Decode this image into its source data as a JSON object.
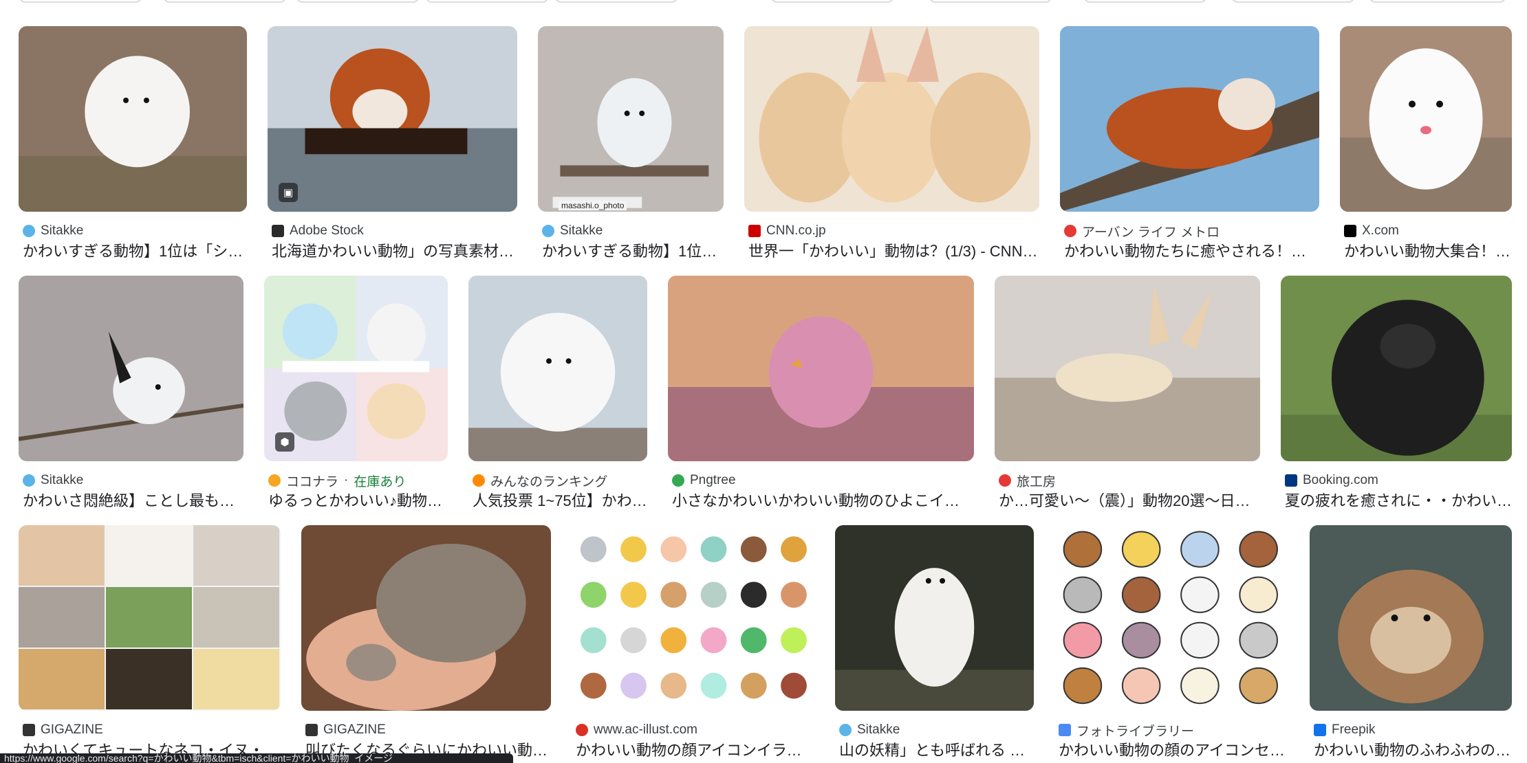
{
  "results": [
    {
      "source": "Sitakke",
      "title": "かわいすぎる動物】1位は「シ…",
      "favicon": "sitakke-icon",
      "fav_color": "#5ab4e8"
    },
    {
      "source": "Adobe Stock",
      "title": "北海道かわいい動物」の写真素材 | …",
      "favicon": "adobe-stock-icon",
      "fav_color": "#2b2b2b",
      "badge": "image-icon"
    },
    {
      "source": "Sitakke",
      "title": "かわいすぎる動物】1位…",
      "favicon": "sitakke-icon",
      "fav_color": "#5ab4e8",
      "watermark": "masashi.o_photo"
    },
    {
      "source": "CNN.co.jp",
      "title": "世界一「かわいい」動物は？(1/3) - CNN.…",
      "favicon": "cnn-icon",
      "fav_color": "#cc0000"
    },
    {
      "source": "アーバン ライフ メトロ",
      "title": "かわいい動物たちに癒やされる！都…",
      "favicon": "urban-life-icon",
      "fav_color": "#e53935"
    },
    {
      "source": "X.com",
      "title": "かわいい動物大集合！ …",
      "favicon": "x-icon",
      "fav_color": "#000000"
    },
    {
      "source": "Sitakke",
      "title": "かわいさ悶絶級】ことし最も「…",
      "favicon": "sitakke-icon",
      "fav_color": "#5ab4e8"
    },
    {
      "source": "ココナラ",
      "source_suffix": "在庫あり",
      "title": "ゆるっとかわいい♪動物…",
      "favicon": "coconala-icon",
      "fav_color": "#f5a623",
      "badge": "tag-icon"
    },
    {
      "source": "みんなのランキング",
      "title": "人気投票 1~75位】かわ…",
      "favicon": "minna-ranking-icon",
      "fav_color": "#ff8a00"
    },
    {
      "source": "Pngtree",
      "title": "小さなかわいいかわいい動物のひよこイラ…",
      "favicon": "pngtree-icon",
      "fav_color": "#34a853"
    },
    {
      "source": "旅工房",
      "title": "か…可愛い〜（震）」動物20選〜日々…",
      "favicon": "tabikobo-icon",
      "fav_color": "#e53935"
    },
    {
      "source": "Booking.com",
      "title": "夏の疲れを癒されに・・かわい…",
      "favicon": "booking-icon",
      "fav_color": "#003580"
    },
    {
      "source": "GIGAZINE",
      "title": "かわいくてキュートなネコ・イヌ・…",
      "favicon": "gigazine-icon",
      "fav_color": "#333333"
    },
    {
      "source": "GIGAZINE",
      "title": "叫びたくなるぐらいにかわいい動…",
      "favicon": "gigazine-icon",
      "fav_color": "#333333"
    },
    {
      "source": "www.ac-illust.com",
      "title": "かわいい動物の顔アイコンイラス…",
      "favicon": "ac-illust-icon",
      "fav_color": "#d93025"
    },
    {
      "source": "Sitakke",
      "title": "山の妖精」とも呼ばれる こ…",
      "favicon": "sitakke-icon",
      "fav_color": "#5ab4e8"
    },
    {
      "source": "フォトライブラリー",
      "title": "かわいい動物の顔のアイコンセ…",
      "favicon": "photolibrary-icon",
      "fav_color": "#4a8af4"
    },
    {
      "source": "Freepik",
      "title": "かわいい動物のふわふわの…",
      "favicon": "freepik-icon",
      "fav_color": "#1273eb"
    }
  ],
  "statusbar": {
    "url": "https://www.google.com/search?q=かわいい動物&tbm=isch&client=かわいい動物_イメージ"
  }
}
